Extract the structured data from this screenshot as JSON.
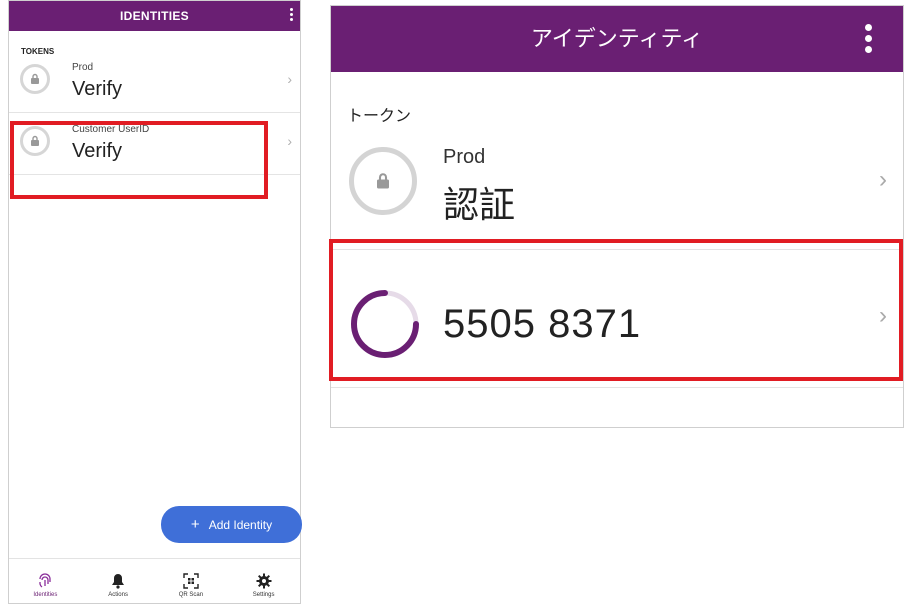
{
  "left_screen": {
    "title": "IDENTITIES",
    "section_label": "TOKENS",
    "rows": [
      {
        "name": "Prod",
        "value": "Verify"
      },
      {
        "name": "Customer UserID",
        "value": "Verify"
      }
    ],
    "add_button": {
      "label": "Add Identity"
    },
    "bottom_nav": [
      {
        "label": "Identities",
        "icon": "fingerprint-icon",
        "active": true
      },
      {
        "label": "Actions",
        "icon": "bell-icon",
        "active": false
      },
      {
        "label": "QR Scan",
        "icon": "qr-scan-icon",
        "active": false
      },
      {
        "label": "Settings",
        "icon": "gear-icon",
        "active": false
      }
    ]
  },
  "right_screen": {
    "title": "アイデンティティ",
    "section_label": "トークン",
    "rows": [
      {
        "name": "Prod",
        "value": "認証"
      },
      {
        "code": "5505 8371"
      }
    ]
  },
  "colors": {
    "app_bar": "#6a1f73",
    "highlight_box": "#e11c23",
    "fab": "#3f6fd8"
  }
}
